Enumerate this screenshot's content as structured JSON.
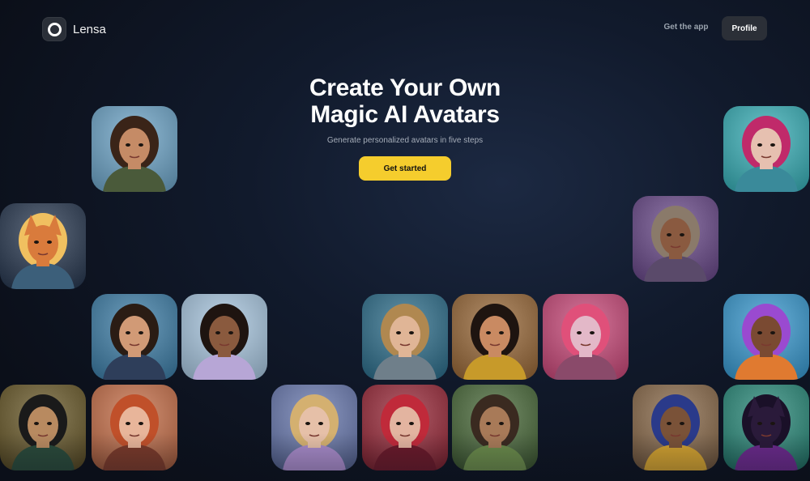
{
  "header": {
    "brand": "Lensa",
    "get_app_label": "Get the app",
    "profile_label": "Profile"
  },
  "hero": {
    "title_line1": "Create Your Own",
    "title_line2": "Magic AI Avatars",
    "subtitle": "Generate personalized avatars in five steps",
    "cta_label": "Get started"
  },
  "colors": {
    "accent": "#f5cd2d",
    "background": "#111a2c",
    "profile_button": "#2b2f37"
  },
  "avatars": [
    {
      "name": "warrior-man",
      "bg": "#6fa6c9",
      "skin": "#c58b66",
      "hair": "#3a2418",
      "cloth": "#4a5a3a",
      "ears": false
    },
    {
      "name": "shiba-dog",
      "bg": "#2a3a52",
      "skin": "#d97b3c",
      "hair": "#f0c060",
      "cloth": "#3c5f7a",
      "ears": true
    },
    {
      "name": "young-man-portrait",
      "bg": "#3f7fa8",
      "skin": "#d19a76",
      "hair": "#2a1c14",
      "cloth": "#2e3e5a",
      "ears": false
    },
    {
      "name": "fairy-woman-butterfly",
      "bg": "#a9c7e0",
      "skin": "#8a5a3e",
      "hair": "#1e1410",
      "cloth": "#b7a6d6",
      "ears": false
    },
    {
      "name": "fairy-woman-wings",
      "bg": "#2f6f8c",
      "skin": "#e0b596",
      "hair": "#b08850",
      "cloth": "#6f7f8a",
      "ears": false
    },
    {
      "name": "egyptian-queen",
      "bg": "#9a6a3a",
      "skin": "#c98a62",
      "hair": "#1e1410",
      "cloth": "#c79a2a",
      "ears": false
    },
    {
      "name": "holographic-woman",
      "bg": "#c94a7a",
      "skin": "#e3b8c8",
      "hair": "#e0507a",
      "cloth": "#8a4a6a",
      "ears": false
    },
    {
      "name": "golden-woman",
      "bg": "#6a5a2a",
      "skin": "#b88a60",
      "hair": "#1a1a1a",
      "cloth": "#2a4a3a",
      "ears": false
    },
    {
      "name": "redhead-woman",
      "bg": "#c7704a",
      "skin": "#e8b59a",
      "hair": "#c0502a",
      "cloth": "#7a3a2a",
      "ears": false
    },
    {
      "name": "butterfly-fairy",
      "bg": "#6a7ab0",
      "skin": "#e6c0a8",
      "hair": "#d4b070",
      "cloth": "#a78ac8",
      "ears": false
    },
    {
      "name": "red-pearl-woman",
      "bg": "#9a2a3a",
      "skin": "#e3b4a0",
      "hair": "#c02a3a",
      "cloth": "#6a1a2a",
      "ears": false
    },
    {
      "name": "flower-crown-woman",
      "bg": "#4a6a3a",
      "skin": "#a87a58",
      "hair": "#3a2a20",
      "cloth": "#6a8a4a",
      "ears": false
    },
    {
      "name": "pearl-pink-hair-woman",
      "bg": "#3ab0b8",
      "skin": "#e6c0b0",
      "hair": "#c02a6a",
      "cloth": "#3a8a9a",
      "ears": false
    },
    {
      "name": "steampunk-woman",
      "bg": "#6a4a8a",
      "skin": "#8a5a40",
      "hair": "#8a7a6a",
      "cloth": "#5a4a6a",
      "ears": false
    },
    {
      "name": "purple-afro-woman",
      "bg": "#3a9ad0",
      "skin": "#7a4a32",
      "hair": "#9a4ad0",
      "cloth": "#e07a30",
      "ears": false
    },
    {
      "name": "pharaoh-man",
      "bg": "#8a6a4a",
      "skin": "#7a5238",
      "hair": "#2a3a8a",
      "cloth": "#d0a030",
      "ears": false
    },
    {
      "name": "cat-art",
      "bg": "#2a8a7a",
      "skin": "#2a1a3a",
      "hair": "#1a1028",
      "cloth": "#6a2a8a",
      "ears": true
    }
  ]
}
